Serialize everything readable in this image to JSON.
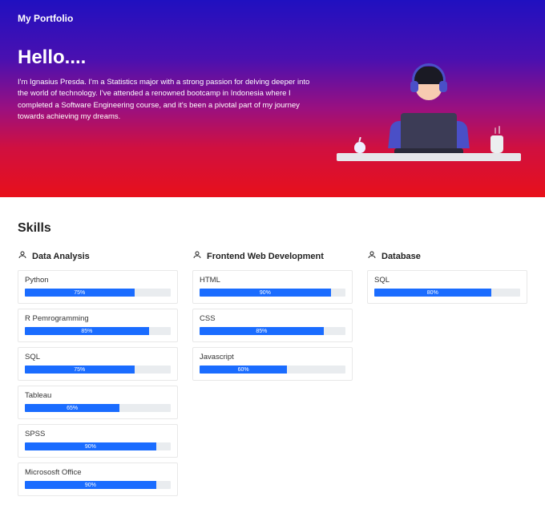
{
  "header": {
    "brand": "My Portfolio"
  },
  "hero": {
    "greeting": "Hello....",
    "intro": "I'm Ignasius Presda. I'm a Statistics major with a strong passion for delving deeper into the world of technology. I've attended a renowned bootcamp in Indonesia where I completed a Software Engineering course, and it's been a pivotal part of my journey towards achieving my dreams."
  },
  "skills": {
    "title": "Skills",
    "columns": [
      {
        "heading": "Data Analysis",
        "items": [
          {
            "name": "Python",
            "pct": 75
          },
          {
            "name": "R Pemrogramming",
            "pct": 85
          },
          {
            "name": "SQL",
            "pct": 75
          },
          {
            "name": "Tableau",
            "pct": 65
          },
          {
            "name": "SPSS",
            "pct": 90
          },
          {
            "name": "Micrososft Office",
            "pct": 90
          }
        ]
      },
      {
        "heading": "Frontend Web Development",
        "items": [
          {
            "name": "HTML",
            "pct": 90
          },
          {
            "name": "CSS",
            "pct": 85
          },
          {
            "name": "Javascript",
            "pct": 60
          }
        ]
      },
      {
        "heading": "Database",
        "items": [
          {
            "name": "SQL",
            "pct": 80
          }
        ]
      }
    ]
  },
  "chart_data": [
    {
      "type": "bar",
      "title": "Data Analysis",
      "categories": [
        "Python",
        "R Pemrogramming",
        "SQL",
        "Tableau",
        "SPSS",
        "Micrososft Office"
      ],
      "values": [
        75,
        85,
        75,
        65,
        90,
        90
      ],
      "ylim": [
        0,
        100
      ]
    },
    {
      "type": "bar",
      "title": "Frontend Web Development",
      "categories": [
        "HTML",
        "CSS",
        "Javascript"
      ],
      "values": [
        90,
        85,
        60
      ],
      "ylim": [
        0,
        100
      ]
    },
    {
      "type": "bar",
      "title": "Database",
      "categories": [
        "SQL"
      ],
      "values": [
        80
      ],
      "ylim": [
        0,
        100
      ]
    }
  ]
}
